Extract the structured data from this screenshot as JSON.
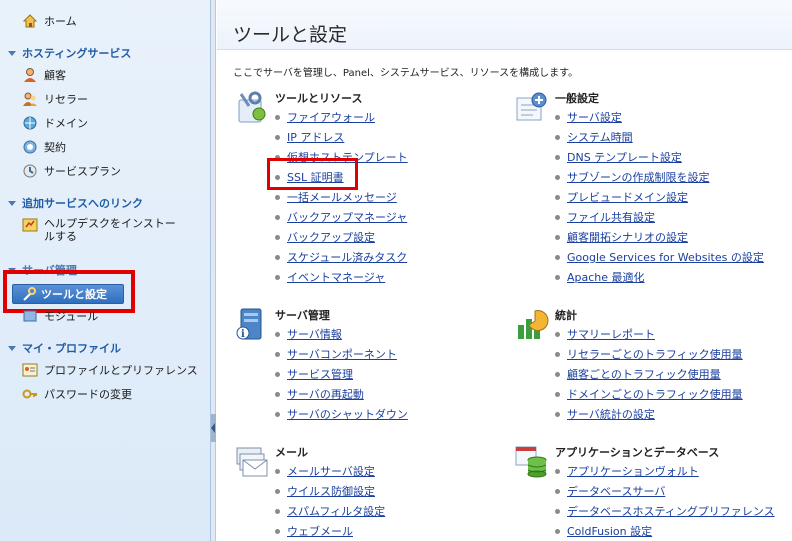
{
  "sidebar": {
    "home": "ホーム",
    "hosting_header": "ホスティングサービス",
    "hosting_items": [
      "顧客",
      "リセラー",
      "ドメイン",
      "契約",
      "サービスプラン"
    ],
    "addon_header": "追加サービスへのリンク",
    "addon_item": "ヘルプデスクをインストールする",
    "server_header": "サーバ管理",
    "server_items": [
      "ツールと設定",
      "モジュール"
    ],
    "profile_header": "マイ・プロファイル",
    "profile_items": [
      "プロファイルとプリファレンス",
      "パスワードの変更"
    ]
  },
  "main": {
    "title": "ツールと設定",
    "description": "ここでサーバを管理し、Panel、システムサービス、リソースを構成します。",
    "sections": [
      {
        "title": "ツールとリソース",
        "icon": "tools-resources-icon",
        "links": [
          "ファイアウォール",
          "IP アドレス",
          "仮想ホストテンプレート",
          "SSL 証明書",
          "一括メールメッセージ",
          "バックアップマネージャ",
          "バックアップ設定",
          "スケジュール済みタスク",
          "イベントマネージャ"
        ]
      },
      {
        "title": "一般設定",
        "icon": "general-settings-icon",
        "links": [
          "サーバ設定",
          "システム時間",
          "DNS テンプレート設定",
          "サブゾーンの作成制限を設定",
          "プレビュードメイン設定",
          "ファイル共有設定",
          "顧客開拓シナリオの設定",
          "Google Services for Websites の設定",
          "Apache 最適化"
        ]
      },
      {
        "title": "サーバ管理",
        "icon": "server-management-icon",
        "links": [
          "サーバ情報",
          "サーバコンポーネント",
          "サービス管理",
          "サーバの再起動",
          "サーバのシャットダウン"
        ]
      },
      {
        "title": "統計",
        "icon": "statistics-icon",
        "links": [
          "サマリーレポート",
          "リセラーごとのトラフィック使用量",
          "顧客ごとのトラフィック使用量",
          "ドメインごとのトラフィック使用量",
          "サーバ統計の設定"
        ]
      },
      {
        "title": "メール",
        "icon": "mail-icon",
        "links": [
          "メールサーバ設定",
          "ウイルス防御設定",
          "スパムフィルタ設定",
          "ウェブメール"
        ]
      },
      {
        "title": "アプリケーションとデータベース",
        "icon": "apps-database-icon",
        "links": [
          "アプリケーションヴォルト",
          "データベースサーバ",
          "データベースホスティングプリファレンス",
          "ColdFusion 設定"
        ]
      }
    ]
  },
  "colors": {
    "link": "#1a3f9f",
    "highlight": "#e00000",
    "sidebar_header": "#1f5ca3",
    "active": "#2f6fc0"
  }
}
